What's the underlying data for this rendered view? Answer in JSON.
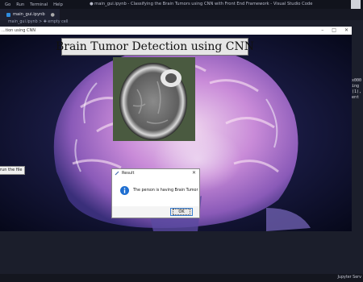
{
  "vscode": {
    "menu": [
      "Go",
      "Run",
      "Terminal",
      "Help"
    ],
    "window_title": "● main_gui.ipynb - Classifying the Brain Tumors using CNN with Front End Framework - Visual Studio Code",
    "tab_label": "main_gui.ipynb",
    "breadcrumb": "main_gui.ipynb > ✚ empty cell",
    "code_peek": [
      "x000",
      "ing",
      "(1),",
      "ent"
    ],
    "status_right": "Jupyter Serv",
    "accent_color": "#2f8ddf"
  },
  "app": {
    "window_title": "...tion using CNN",
    "heading": "Brain Tumor Detection using CNN",
    "run_button": "run the file"
  },
  "dialog": {
    "title": "Result",
    "message": "The person is having Brain Tumor",
    "ok_label": "OK"
  }
}
